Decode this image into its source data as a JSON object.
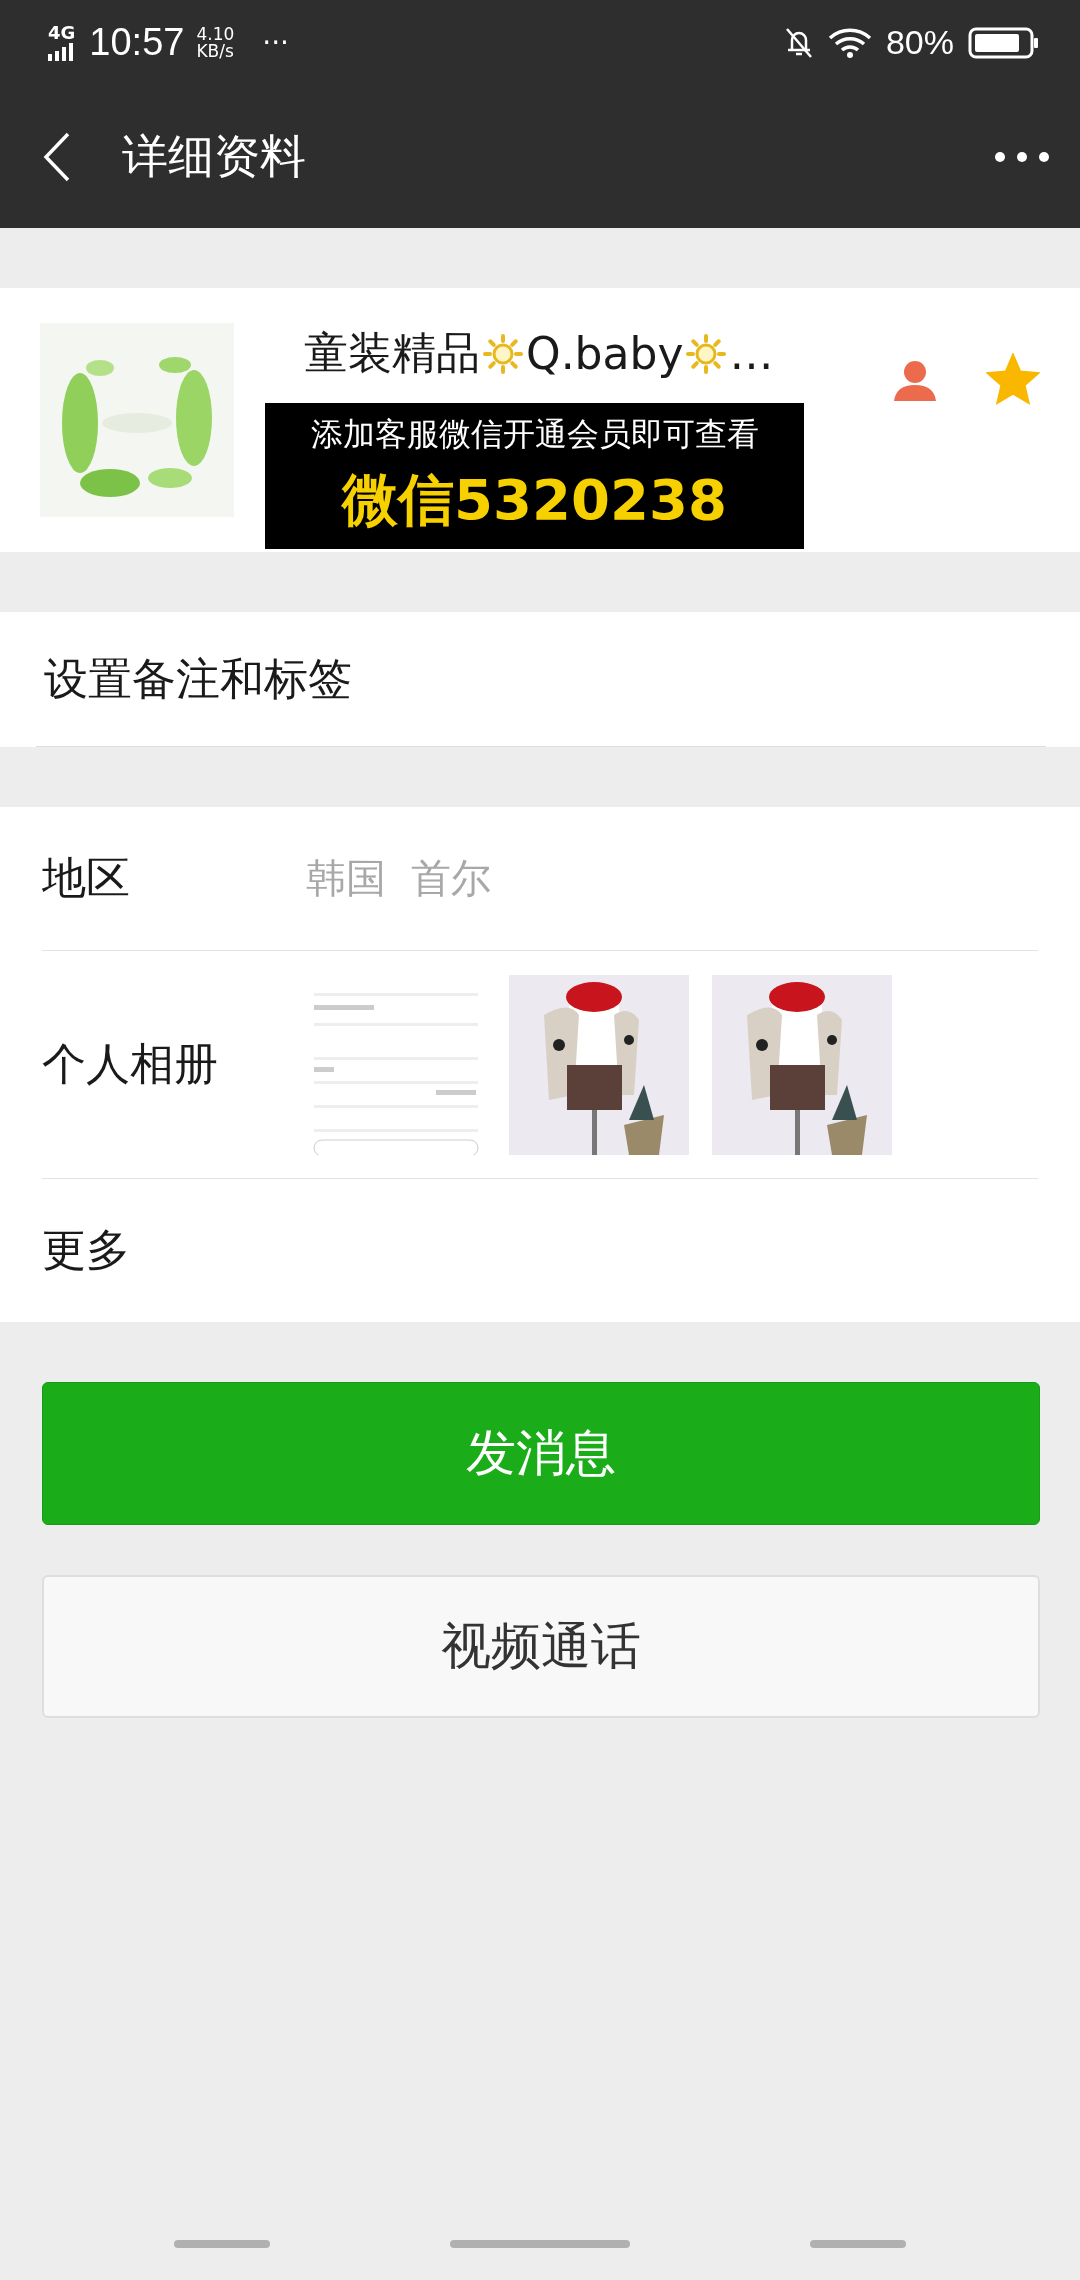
{
  "status_bar": {
    "network": "4G",
    "time": "10:57",
    "speed_value": "4.10",
    "speed_unit": "KB/s",
    "more": "···",
    "battery": "80%"
  },
  "nav_bar": {
    "title": "详细资料"
  },
  "profile": {
    "name_segments": [
      {
        "kind": "text",
        "text": "童装精品"
      },
      {
        "kind": "sun"
      },
      {
        "kind": "text",
        "text": "Q.baby"
      },
      {
        "kind": "sun"
      },
      {
        "kind": "text",
        "text": "…"
      }
    ],
    "starred": true
  },
  "overlay_banner": {
    "line1": "添加客服微信开通会员即可查看",
    "line2": "微信5320238"
  },
  "remark_row": {
    "label": "设置备注和标签"
  },
  "info_rows": [
    {
      "kind": "text",
      "label": "地区",
      "value": "韩国  首尔"
    },
    {
      "kind": "album",
      "label": "个人相册"
    },
    {
      "kind": "text",
      "label": "更多"
    }
  ],
  "buttons": [
    {
      "kind": "primary",
      "label": "发消息"
    },
    {
      "kind": "secondary",
      "label": "视频通话"
    }
  ]
}
